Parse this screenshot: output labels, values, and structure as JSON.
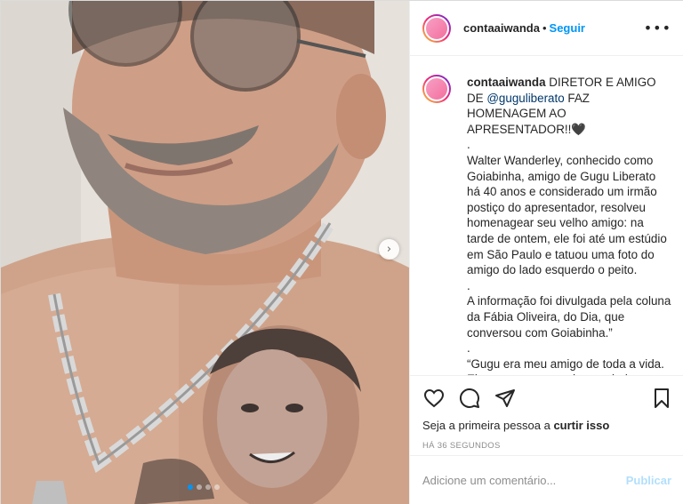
{
  "post": {
    "username": "contaaiwanda",
    "separator": "•",
    "follow_label": "Seguir",
    "more_icon": "more-options-icon",
    "avatar_text": "conta ai wanda"
  },
  "caption": {
    "username": "contaaiwanda",
    "line1": "DIRETOR E AMIGO DE",
    "mention": "@guguliberato",
    "line2": "FAZ HOMENAGEM AO APRESENTADOR!!🖤",
    "dot1": ".",
    "para1": "Walter Wanderley, conhecido como Goiabinha, amigo de Gugu Liberato há 40 anos e considerado um irmão postiço do apresentador, resolveu homenagear seu velho amigo: na tarde de ontem, ele foi até um estúdio em São Paulo e tatuou uma foto do amigo do lado esquerdo o peito.",
    "dot2": ".",
    "para2": "A informação foi divulgada pela coluna da Fábia Oliveira, do Dia, que conversou com Goiabinha.”",
    "dot3": ".",
    "para3": "“Gugu era meu amigo de toda a vida. Ele sempre esteve do meu lado, dentro e fora da TV. A música diz que"
  },
  "actions": {
    "like_icon": "heart-icon",
    "comment_icon": "comment-icon",
    "share_icon": "share-icon",
    "save_icon": "bookmark-icon",
    "likes_prefix": "Seja a primeira pessoa a",
    "likes_cta": "curtir isso",
    "timestamp": "HÁ 36 SEGUNDOS"
  },
  "comment_box": {
    "placeholder": "Adicione um comentário...",
    "publish_label": "Publicar"
  },
  "carousel": {
    "next_icon": "chevron-right-icon",
    "current": 1,
    "total": 4
  },
  "colors": {
    "accent": "#0095f6",
    "mention": "#00376b",
    "muted": "#8e8e8e",
    "publish_disabled": "#b2dffc"
  }
}
